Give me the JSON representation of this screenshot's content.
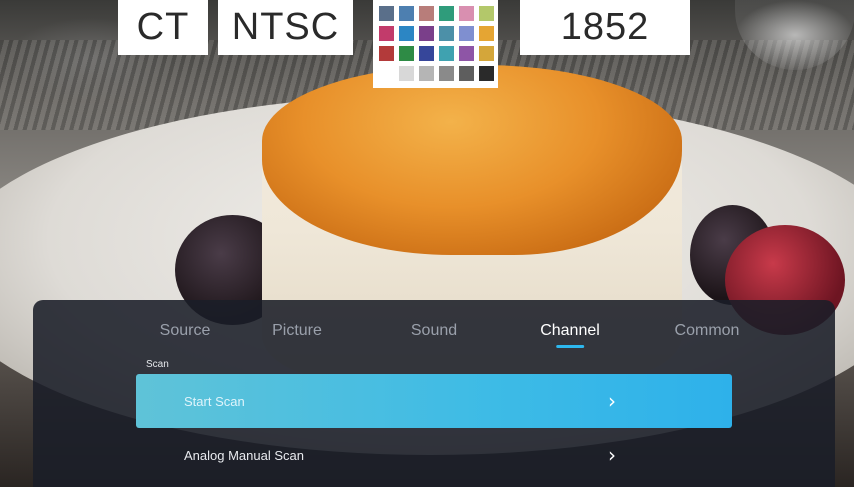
{
  "overlay": {
    "tags": [
      "CT",
      "NTSC",
      "1852"
    ],
    "swatch_colors": [
      "#5a6f8a",
      "#4d7fb0",
      "#b87d7a",
      "#2f9c7b",
      "#d98fb0",
      "#b3c86a",
      "#c23b6b",
      "#2c86c4",
      "#7a3f8a",
      "#4c90a8",
      "#7f8fd0",
      "#e5a533",
      "#b33a3a",
      "#2e8b45",
      "#36469a",
      "#3fa2b0",
      "#8e55a6",
      "#d4a63a",
      "#ffffff",
      "#d8d8d8",
      "#b5b5b5",
      "#8a8a8a",
      "#5e5e5e",
      "#2a2a2a"
    ]
  },
  "menu": {
    "tabs": [
      {
        "label": "Source",
        "active": false
      },
      {
        "label": "Picture",
        "active": false
      },
      {
        "label": "Sound",
        "active": false
      },
      {
        "label": "Channel",
        "active": true
      },
      {
        "label": "Common",
        "active": false
      }
    ],
    "section_label": "Scan",
    "items": [
      {
        "label": "Start Scan",
        "icon": "chevron-right-icon",
        "selected": true
      },
      {
        "label": "Analog Manual Scan",
        "icon": "chevron-right-icon",
        "selected": false
      }
    ],
    "accent_color": "#2db7ee"
  }
}
